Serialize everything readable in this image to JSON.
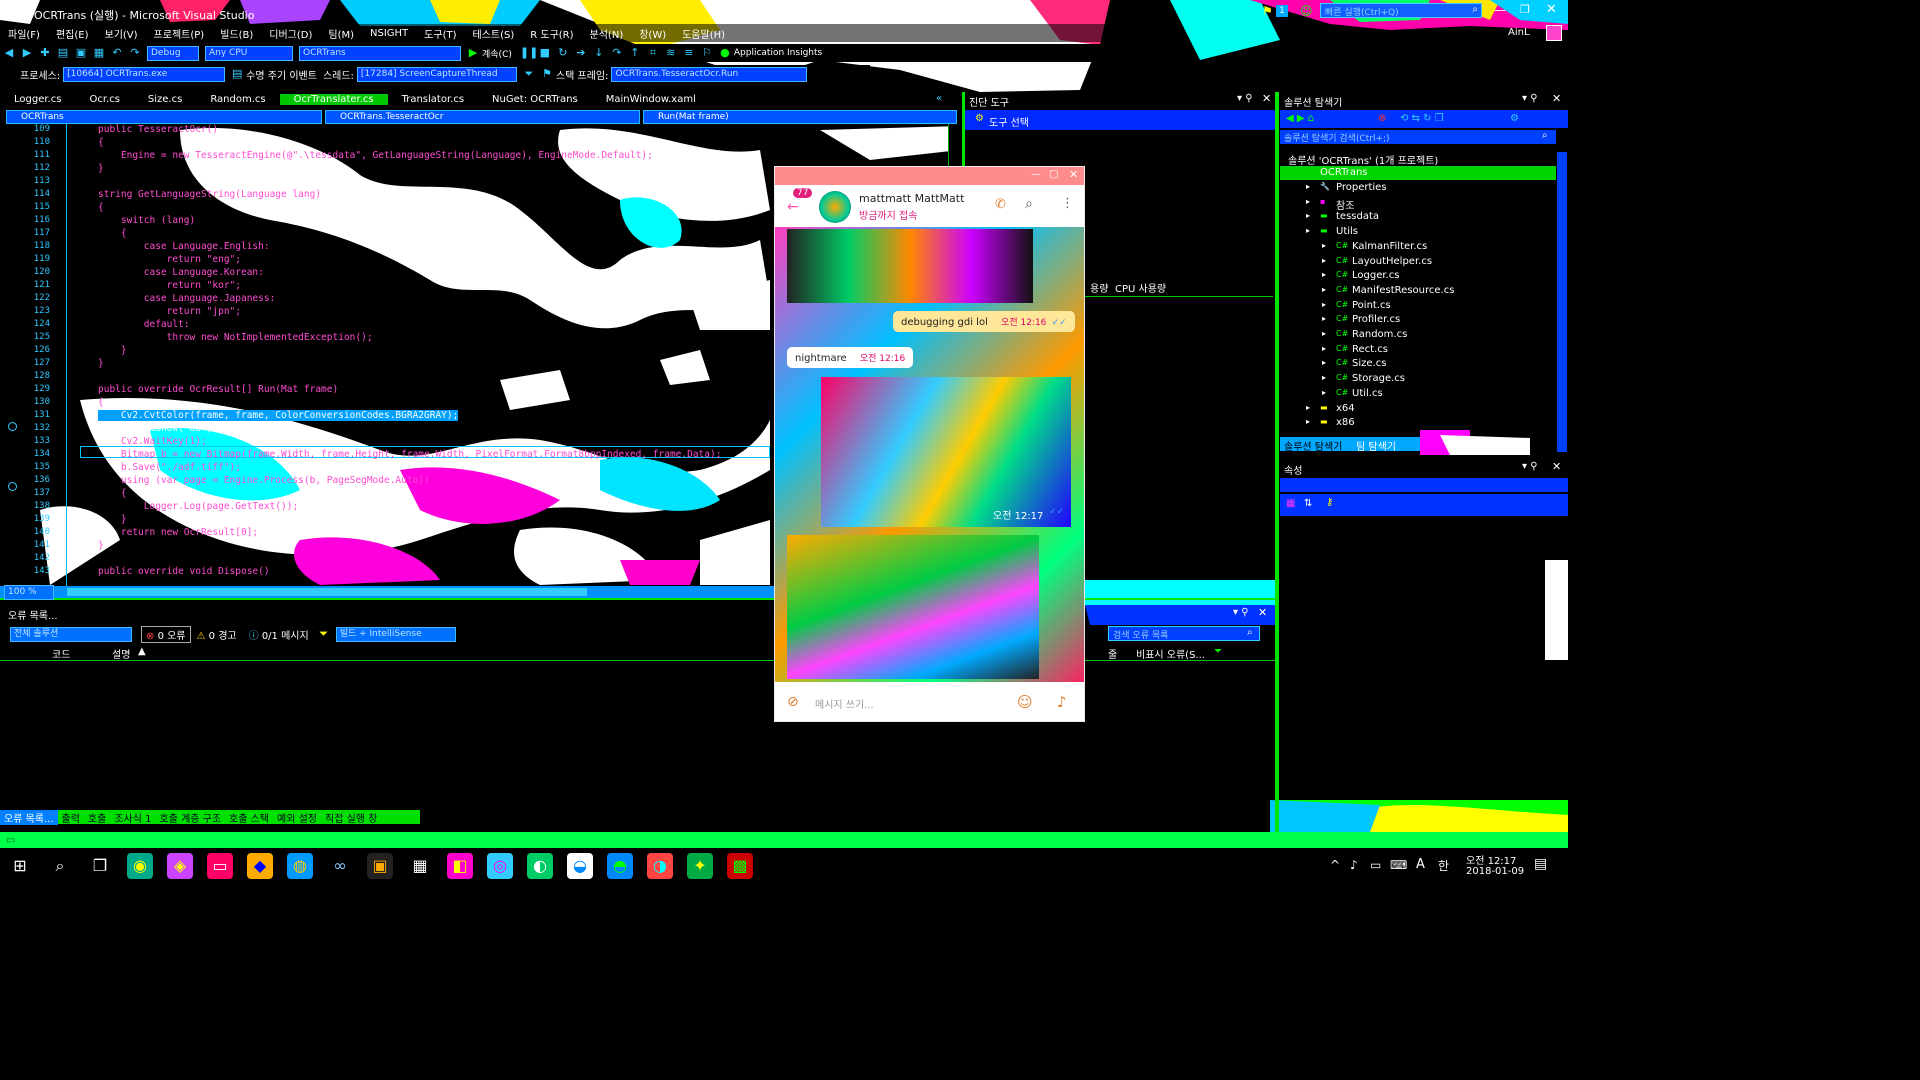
{
  "window": {
    "title": "OCRTrans (실행) - Microsoft Visual Studio",
    "search_placeholder": "빠른 실행(Ctrl+Q)",
    "user": "AinL",
    "notification_count": "1"
  },
  "menu": [
    "파일(F)",
    "편집(E)",
    "보기(V)",
    "프로젝트(P)",
    "빌드(B)",
    "디버그(D)",
    "팀(M)",
    "NSIGHT",
    "도구(T)",
    "테스트(S)",
    "R 도구(R)",
    "분석(N)",
    "창(W)",
    "도움말(H)"
  ],
  "toolbar": {
    "config": "Debug",
    "platform": "Any CPU",
    "project": "OCRTrans",
    "continue": "계속(C)",
    "app_insights": "Application Insights"
  },
  "debug_bar": {
    "process_label": "프로세스:",
    "process": "[10664] OCRTrans.exe",
    "lifecycle": "수명 주기 이벤트",
    "thread_label": "스레드:",
    "thread": "[17284] ScreenCaptureThread",
    "stack_label": "스택 프레임:",
    "stack": "OCRTrans.TesseractOcr.Run"
  },
  "editor_tabs": [
    "Logger.cs",
    "Ocr.cs",
    "Size.cs",
    "Random.cs",
    "OcrTranslater.cs",
    "Translator.cs",
    "NuGet: OCRTrans",
    "MainWindow.xaml"
  ],
  "active_tab": "OcrTranslater.cs",
  "nav": {
    "project": "OCRTrans",
    "class": "OCRTrans.TesseractOcr",
    "member": "Run(Mat frame)"
  },
  "code_lines": [
    {
      "n": "109",
      "text": "public TesseractOcr()"
    },
    {
      "n": "110",
      "text": "{"
    },
    {
      "n": "111",
      "text": "    Engine = new TesseractEngine(@\".\\tessdata\", GetLanguageString(Language), EngineMode.Default);"
    },
    {
      "n": "112",
      "text": "}"
    },
    {
      "n": "113",
      "text": ""
    },
    {
      "n": "114",
      "text": "string GetLanguageString(Language lang)"
    },
    {
      "n": "115",
      "text": "{"
    },
    {
      "n": "116",
      "text": "    switch (lang)"
    },
    {
      "n": "117",
      "text": "    {"
    },
    {
      "n": "118",
      "text": "        case Language.English:"
    },
    {
      "n": "119",
      "text": "            return \"eng\";"
    },
    {
      "n": "120",
      "text": "        case Language.Korean:"
    },
    {
      "n": "121",
      "text": "            return \"kor\";"
    },
    {
      "n": "122",
      "text": "        case Language.Japaness:"
    },
    {
      "n": "123",
      "text": "            return \"jpn\";"
    },
    {
      "n": "124",
      "text": "        default:"
    },
    {
      "n": "125",
      "text": "            throw new NotImplementedException();"
    },
    {
      "n": "126",
      "text": "    }"
    },
    {
      "n": "127",
      "text": "}"
    },
    {
      "n": "128",
      "text": ""
    },
    {
      "n": "129",
      "text": "public override OcrResult[] Run(Mat frame)"
    },
    {
      "n": "130",
      "text": "{"
    },
    {
      "n": "131",
      "text": "    Cv2.CvtColor(frame, frame, ColorConversionCodes.BGRA2GRAY);"
    },
    {
      "n": "132",
      "text": "    Cv2.ImShow(\"aa\", frame);"
    },
    {
      "n": "133",
      "text": "    Cv2.WaitKey(1);"
    },
    {
      "n": "134",
      "text": "    Bitmap b = new Bitmap(frame.Width, frame.Height, frame.Width, PixelFormat.Format8bppIndexed, frame.Data);"
    },
    {
      "n": "135",
      "text": "    b.Save(\"./adf.tiff\");"
    },
    {
      "n": "136",
      "text": "    using (var page = Engine.Process(b, PageSegMode.Auto))"
    },
    {
      "n": "137",
      "text": "    {"
    },
    {
      "n": "138",
      "text": "        Logger.Log(page.GetText());"
    },
    {
      "n": "139",
      "text": "    }"
    },
    {
      "n": "140",
      "text": "    return new OcrResult[0];"
    },
    {
      "n": "141",
      "text": "}"
    },
    {
      "n": "142",
      "text": ""
    },
    {
      "n": "143",
      "text": "public override void Dispose()"
    }
  ],
  "zoom": "100 %",
  "diagnostics": {
    "title": "진단 도구",
    "select_tools": "도구 선택",
    "memory_label": "용량",
    "cpu_label": "CPU 사용량"
  },
  "solution_explorer": {
    "title": "솔루션 탐색기",
    "search_placeholder": "솔루션 탐색기 검색(Ctrl+;)",
    "solution": "솔루션 'OCRTrans' (1개 프로젝트)",
    "project": "OCRTrans",
    "items": [
      "Properties",
      "참조",
      "tessdata",
      "Utils"
    ],
    "utils_files": [
      "KalmanFilter.cs",
      "LayoutHelper.cs",
      "Logger.cs",
      "ManifestResource.cs",
      "Point.cs",
      "Profiler.cs",
      "Random.cs",
      "Rect.cs",
      "Size.cs",
      "Storage.cs",
      "Util.cs"
    ],
    "folders_after": [
      "x64",
      "x86"
    ],
    "bottom_tabs": [
      "솔루션 탐색기",
      "팀 탐색기"
    ]
  },
  "properties": {
    "title": "속성"
  },
  "error_list": {
    "title": "오류 목록...",
    "scope": "전체 솔루션",
    "errors": "0 오류",
    "warnings": "0 경고",
    "messages": "0/1 메시지",
    "build_filter": "빌드 + IntelliSense",
    "search_placeholder": "검색 오류 목록",
    "col_code": "코드",
    "col_desc": "설명",
    "col_line": "줄",
    "col_suppress": "비표시 오류(S..."
  },
  "bottom_tabs": [
    "오류 목록...",
    "출력",
    "호출",
    "조사식 1",
    "호출 계층 구조",
    "호출 스택",
    "예외 설정",
    "직접 실행 창"
  ],
  "chat": {
    "badge": "77",
    "name": "mattmatt MattMatt",
    "status": "방금까지 접속",
    "sent_message": "debugging gdi lol",
    "sent_time": "오전 12:16",
    "received_message": "nightmare",
    "received_time": "오전 12:16",
    "photo_time": "오전 12:17",
    "input_placeholder": "메시지 쓰기..."
  },
  "taskbar": {
    "time": "오전 12:17",
    "date": "2018-01-09",
    "ime_letter": "A",
    "ime_lang": "한"
  }
}
